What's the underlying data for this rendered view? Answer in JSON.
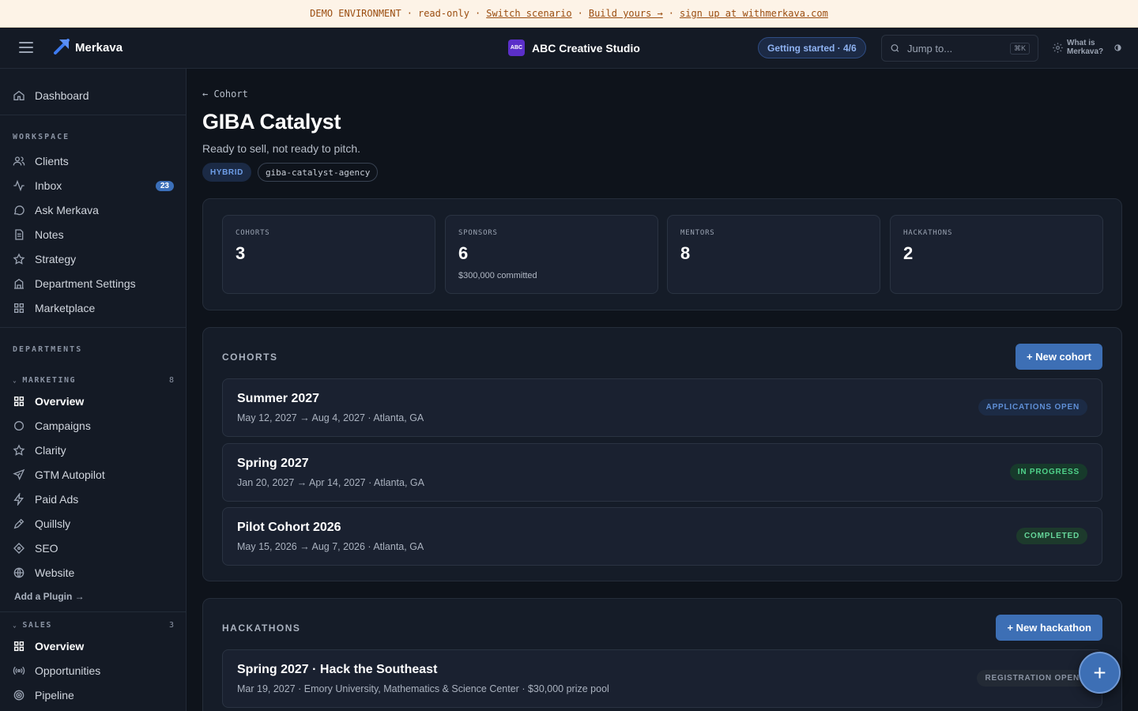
{
  "banner": {
    "env": "DEMO ENVIRONMENT",
    "sep": "·",
    "readonly": "read-only",
    "switch": "Switch scenario",
    "build": "Build yours →",
    "signup": "sign up at withmerkava.com"
  },
  "topbar": {
    "logo_text": "Merkava",
    "org_badge": "ABC",
    "org_name": "ABC Creative Studio",
    "getting_started": "Getting started · 4/6",
    "search_placeholder": "Jump to...",
    "search_kbd": "⌘K",
    "what_is": "What is Merkava?"
  },
  "sidebar": {
    "dashboard": "Dashboard",
    "workspace_label": "WORKSPACE",
    "workspace": [
      {
        "label": "Clients",
        "icon": "users-icon"
      },
      {
        "label": "Inbox",
        "icon": "activity-icon",
        "badge": "23"
      },
      {
        "label": "Ask Merkava",
        "icon": "chat-icon"
      },
      {
        "label": "Notes",
        "icon": "document-icon"
      },
      {
        "label": "Strategy",
        "icon": "star-icon"
      },
      {
        "label": "Department Settings",
        "icon": "building-icon"
      },
      {
        "label": "Marketplace",
        "icon": "grid-icon"
      }
    ],
    "departments_label": "DEPARTMENTS",
    "marketing": {
      "label": "MARKETING",
      "count": "8",
      "items": [
        {
          "label": "Overview",
          "icon": "grid-icon",
          "active": true
        },
        {
          "label": "Campaigns",
          "icon": "circle-icon"
        },
        {
          "label": "Clarity",
          "icon": "star-icon"
        },
        {
          "label": "GTM Autopilot",
          "icon": "send-icon"
        },
        {
          "label": "Paid Ads",
          "icon": "bolt-icon"
        },
        {
          "label": "Quillsly",
          "icon": "pen-icon"
        },
        {
          "label": "SEO",
          "icon": "diamond-icon"
        },
        {
          "label": "Website",
          "icon": "globe-icon"
        }
      ],
      "add_plugin": "Add a Plugin →"
    },
    "sales": {
      "label": "SALES",
      "count": "3",
      "items": [
        {
          "label": "Overview",
          "icon": "grid-icon",
          "active": true
        },
        {
          "label": "Opportunities",
          "icon": "broadcast-icon"
        },
        {
          "label": "Pipeline",
          "icon": "target-icon"
        }
      ]
    }
  },
  "page": {
    "back": "← Cohort",
    "title": "GIBA Catalyst",
    "subtitle": "Ready to sell, not ready to pitch.",
    "chip_type": "HYBRID",
    "chip_slug": "giba-catalyst-agency"
  },
  "stats": [
    {
      "label": "COHORTS",
      "value": "3",
      "note": ""
    },
    {
      "label": "SPONSORS",
      "value": "6",
      "note": "$300,000 committed"
    },
    {
      "label": "MENTORS",
      "value": "8",
      "note": ""
    },
    {
      "label": "HACKATHONS",
      "value": "2",
      "note": ""
    }
  ],
  "cohorts": {
    "title": "COHORTS",
    "new_button": "+ New cohort",
    "items": [
      {
        "name": "Summer 2027",
        "meta": "May 12, 2027 → Aug 4, 2027 · Atlanta, GA",
        "status": "APPLICATIONS OPEN"
      },
      {
        "name": "Spring 2027",
        "meta": "Jan 20, 2027 → Apr 14, 2027 · Atlanta, GA",
        "status": "IN PROGRESS"
      },
      {
        "name": "Pilot Cohort 2026",
        "meta": "May 15, 2026 → Aug 7, 2026 · Atlanta, GA",
        "status": "COMPLETED"
      }
    ]
  },
  "hackathons": {
    "title": "HACKATHONS",
    "new_button": "+ New hackathon",
    "items": [
      {
        "name": "Spring 2027 · Hack the Southeast",
        "meta": "Mar 19, 2027 · Emory University, Mathematics & Science Center · $30,000 prize pool",
        "status": "REGISTRATION OPEN"
      }
    ]
  },
  "fab_label": "+",
  "colors": {
    "accent": "#3d6fb5",
    "banner_bg": "#fdf3e7",
    "banner_text": "#9a4d10",
    "status_green": "#4fd28a",
    "status_blue": "#5f8fd6"
  }
}
